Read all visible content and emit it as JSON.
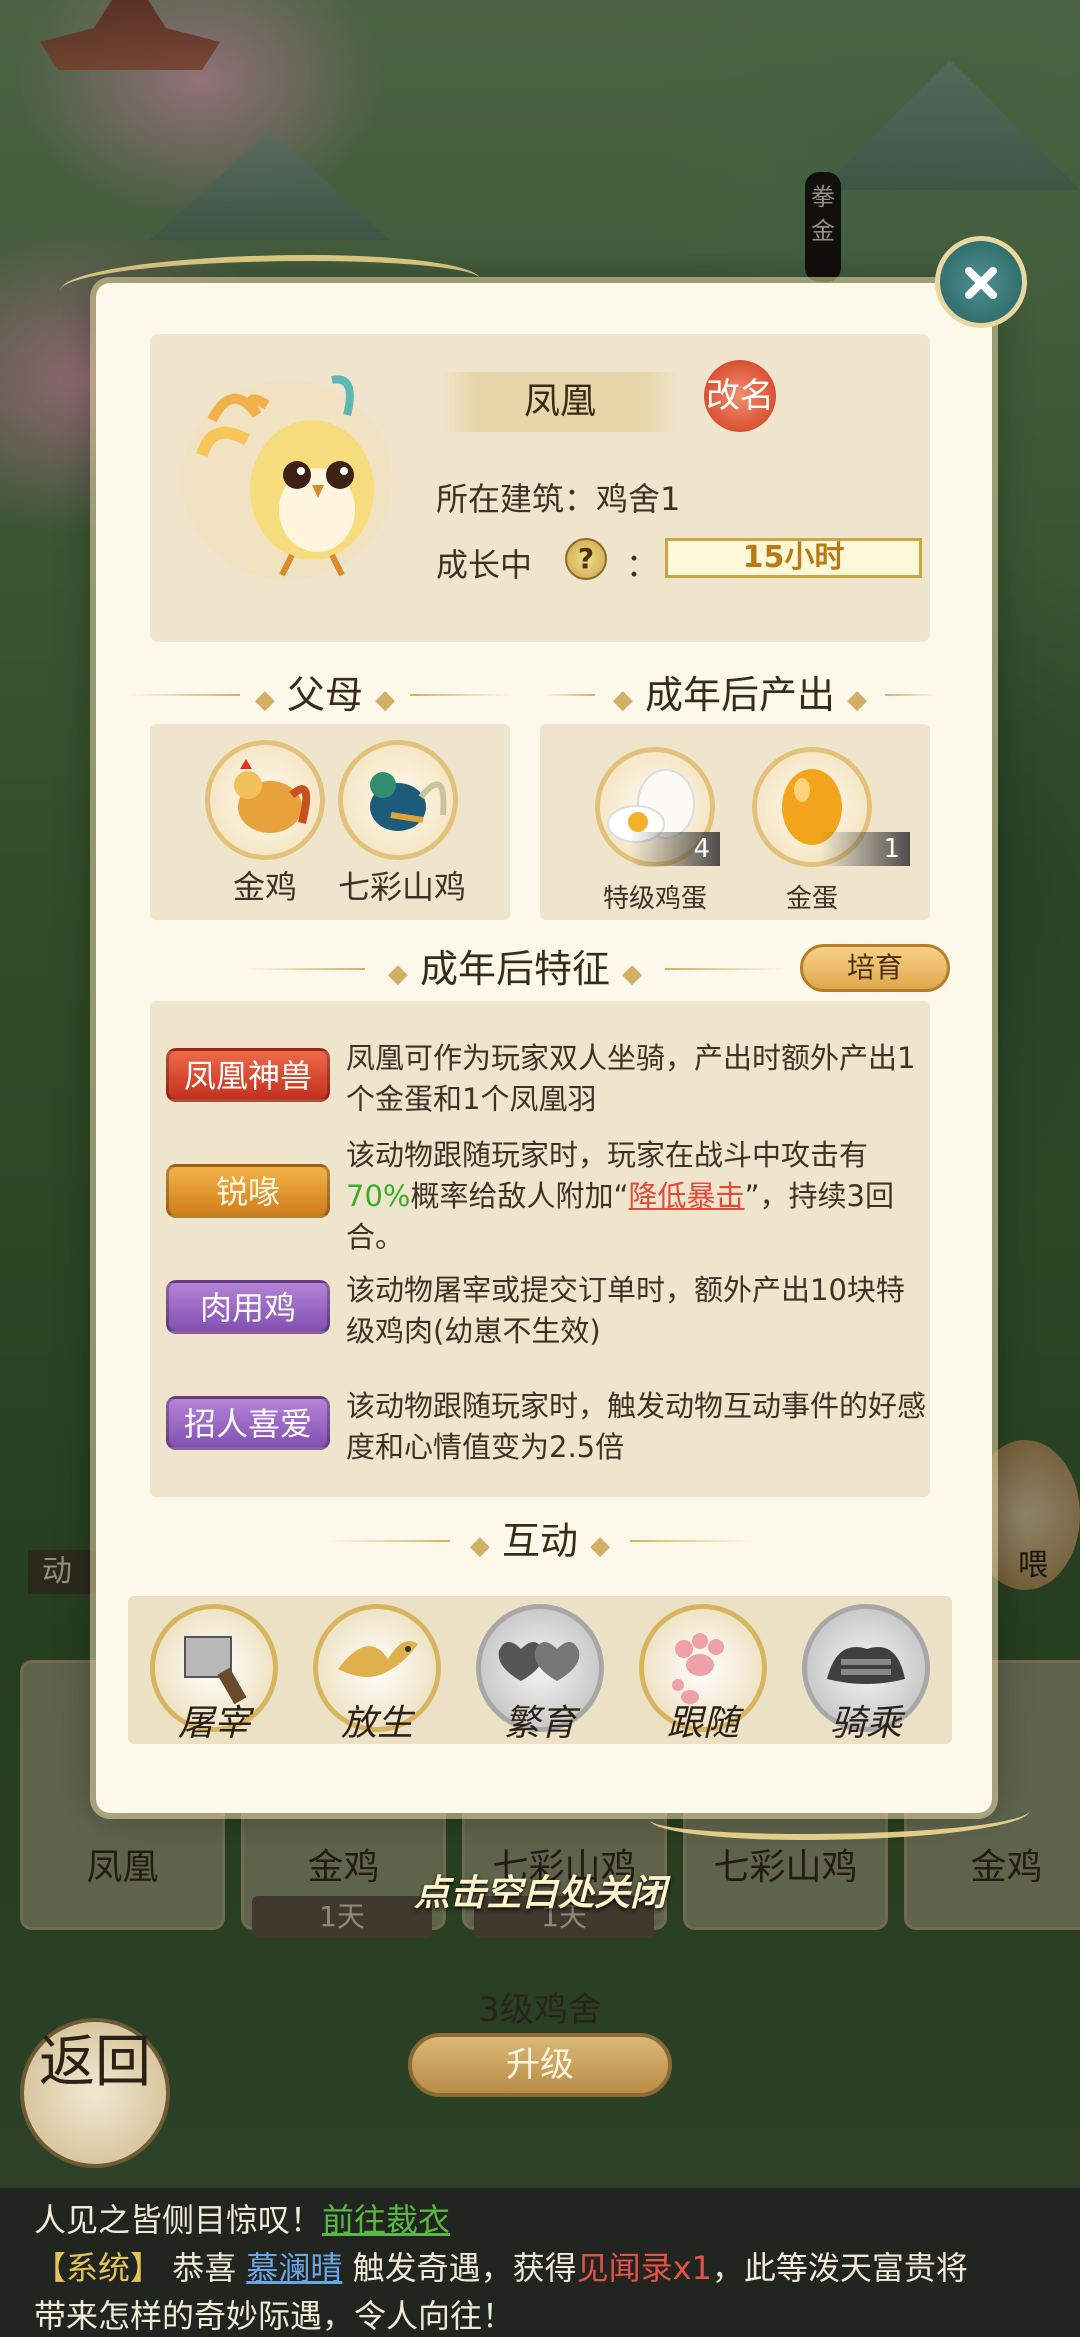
{
  "background": {
    "scroll_banner": "拳金",
    "side_label": "动",
    "feed_label": "喂",
    "slots": [
      {
        "name": "凤凰",
        "time": ""
      },
      {
        "name": "金鸡",
        "time": "1天"
      },
      {
        "name": "七彩山鸡",
        "time": "1天"
      },
      {
        "name": "七彩山鸡",
        "time": ""
      },
      {
        "name": "金鸡",
        "time": ""
      }
    ],
    "building_level": "3级鸡舍",
    "upgrade_label": "升级",
    "back_label": "返回"
  },
  "modal": {
    "pet_name": "凤凰",
    "rename_label": "改名",
    "building_line": "所在建筑：鸡舍1",
    "status_label": "成长中",
    "help_glyph": "?",
    "colon": "：",
    "timer": "15小时",
    "parents": {
      "heading": "父母",
      "items": [
        {
          "name": "金鸡"
        },
        {
          "name": "七彩山鸡"
        }
      ]
    },
    "output": {
      "heading": "成年后产出",
      "items": [
        {
          "name": "特级鸡蛋",
          "count": "4"
        },
        {
          "name": "金蛋",
          "count": "1"
        }
      ]
    },
    "traits": {
      "heading": "成年后特征",
      "breed_label": "培育",
      "items": [
        {
          "tag": "凤凰神兽",
          "text": "凤凰可作为玩家双人坐骑，产出时额外产出1个金蛋和1个凤凰羽"
        },
        {
          "tag": "锐喙",
          "text_a": "该动物跟随玩家时，玩家在战斗中攻击有",
          "percent": "70%",
          "text_b": "概率给敌人附加“",
          "link": "降低暴击",
          "text_c": "”，持续3回合。"
        },
        {
          "tag": "肉用鸡",
          "text": "该动物屠宰或提交订单时，额外产出10块特级鸡肉(幼崽不生效)"
        },
        {
          "tag": "招人喜爱",
          "text": "该动物跟随玩家时，触发动物互动事件的好感度和心情值变为2.5倍"
        }
      ]
    },
    "interact": {
      "heading": "互动",
      "actions": [
        {
          "label": "屠宰",
          "icon": "cleaver-icon"
        },
        {
          "label": "放生",
          "icon": "bird-icon"
        },
        {
          "label": "繁育",
          "icon": "hearts-icon"
        },
        {
          "label": "跟随",
          "icon": "pawprints-icon"
        },
        {
          "label": "骑乘",
          "icon": "saddle-icon"
        }
      ]
    },
    "close_hint": "点击空白处关闭"
  },
  "chat": {
    "line1_text": "人见之皆侧目惊叹！",
    "line1_link": "前往裁衣",
    "line2_sys": "【系统】",
    "line2_a": " 恭喜 ",
    "line2_name": "慕澜晴",
    "line2_b": " 触发奇遇，获得",
    "line2_item": "见闻录x1",
    "line2_c": "，此等泼天富贵将",
    "line3": "带来怎样的奇妙际遇，令人向往！"
  },
  "colors": {
    "gold": "#d1b066",
    "green_percent": "#3aae2c",
    "red_link": "#e04a3a",
    "modal_bg": "#fcf8ea"
  }
}
